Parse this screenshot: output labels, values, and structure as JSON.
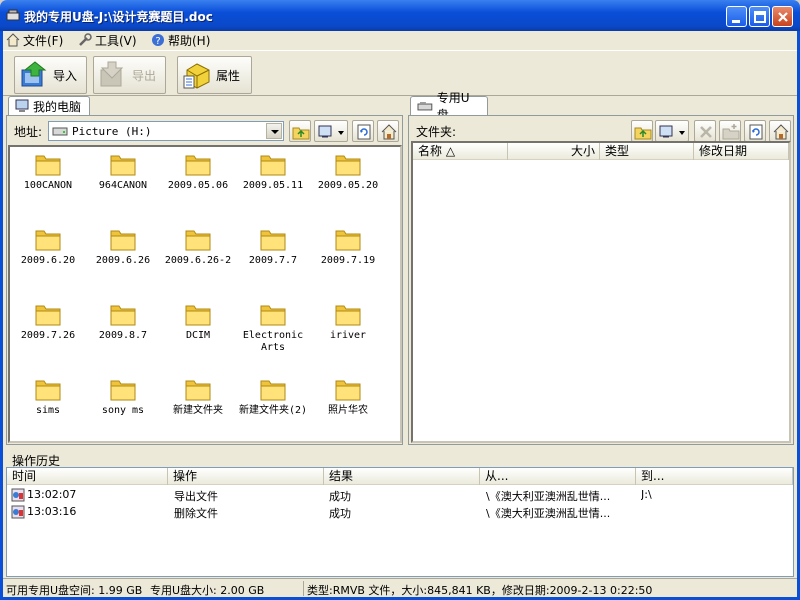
{
  "window": {
    "title": "我的专用U盘-J:\\设计竞赛题目.doc"
  },
  "menu": {
    "file": "文件(F)",
    "tools": "工具(V)",
    "help": "帮助(H)"
  },
  "toolbar": {
    "import": "导入",
    "export": "导出",
    "properties": "属性"
  },
  "left_panel": {
    "tab": "我的电脑",
    "address_label": "地址:",
    "address_value": "Picture (H:)",
    "folders": [
      "100CANON",
      "964CANON",
      "2009.05.06",
      "2009.05.11",
      "2009.05.20",
      "2009.6.20",
      "2009.6.26",
      "2009.6.26-2",
      "2009.7.7",
      "2009.7.19",
      "2009.7.26",
      "2009.8.7",
      "DCIM",
      "Electronic Arts",
      "iriver",
      "sims",
      "sony ms",
      "新建文件夹",
      "新建文件夹(2)",
      "照片华农"
    ]
  },
  "right_panel": {
    "tab": "专用U盘",
    "folder_label": "文件夹:",
    "folder_value": "\\",
    "columns": {
      "name": "名称 △",
      "size": "大小",
      "type": "类型",
      "modified": "修改日期"
    }
  },
  "history": {
    "label": "操作历史",
    "columns": {
      "time": "时间",
      "action": "操作",
      "result": "结果",
      "from": "从...",
      "to": "到..."
    },
    "rows": [
      {
        "time": "13:02:07",
        "action": "导出文件",
        "result": "成功",
        "from": "\\《澳大利亚澳洲乱世情...",
        "to": "J:\\"
      },
      {
        "time": "13:03:16",
        "action": "删除文件",
        "result": "成功",
        "from": "\\《澳大利亚澳洲乱世情...",
        "to": ""
      }
    ]
  },
  "status": {
    "free_space": "可用专用U盘空间: 1.99 GB",
    "total_size": "专用U盘大小: 2.00 GB",
    "file_info": "类型:RMVB 文件，大小:845,841 KB，修改日期:2009-2-13 0:22:50"
  }
}
